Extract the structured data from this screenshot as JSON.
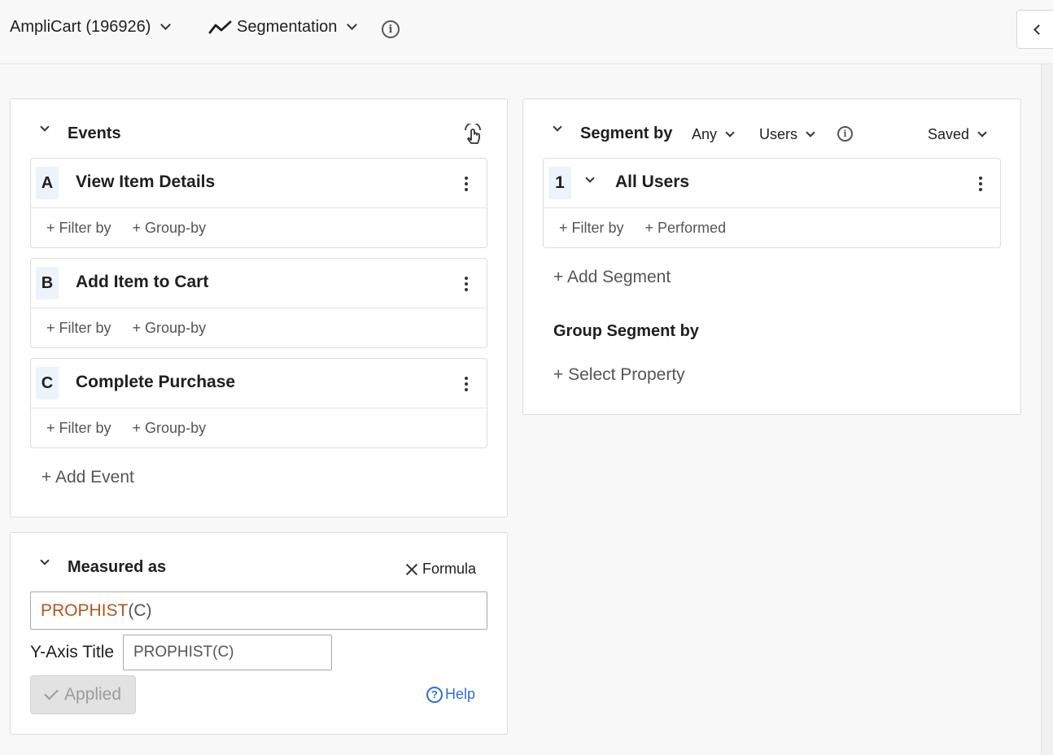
{
  "header": {
    "project": "AmpliCart (196926)",
    "chart_type": "Segmentation"
  },
  "events_panel": {
    "title": "Events",
    "events": [
      {
        "letter": "A",
        "name": "View Item Details",
        "filter": "+ Filter by",
        "group": "+ Group-by"
      },
      {
        "letter": "B",
        "name": "Add Item to Cart",
        "filter": "+ Filter by",
        "group": "+ Group-by"
      },
      {
        "letter": "C",
        "name": "Complete Purchase",
        "filter": "+ Filter by",
        "group": "+ Group-by"
      }
    ],
    "add_event": "+ Add Event"
  },
  "measured_panel": {
    "title": "Measured as",
    "mode": "Formula",
    "formula_fn": "PROPHIST",
    "formula_arg": "(C)",
    "yaxis_label": "Y-Axis Title",
    "yaxis_value": "PROPHIST(C)",
    "applied": "Applied",
    "help": "Help"
  },
  "segment_panel": {
    "title": "Segment by",
    "any": "Any",
    "users": "Users",
    "saved": "Saved",
    "segments": [
      {
        "index": "1",
        "name": "All Users",
        "filter": "+ Filter by",
        "performed": "+ Performed"
      }
    ],
    "add_segment": "+ Add Segment",
    "group_title": "Group Segment by",
    "select_property": "+ Select Property"
  }
}
